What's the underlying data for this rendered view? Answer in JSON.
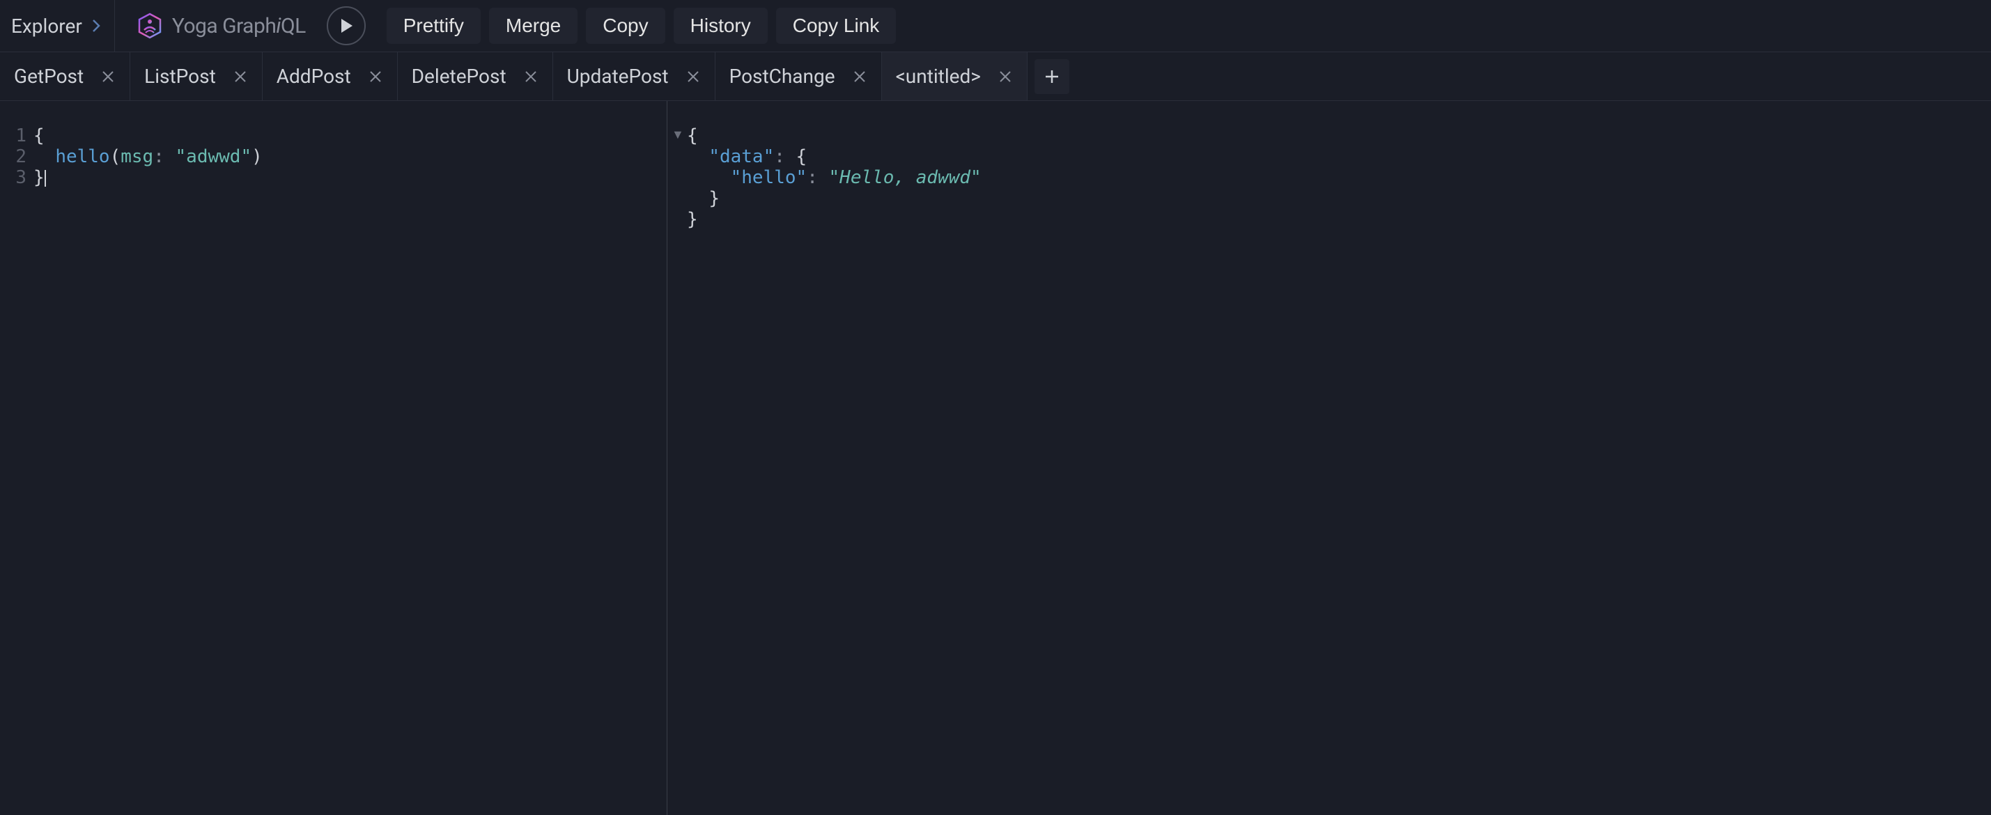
{
  "topbar": {
    "explorer_label": "Explorer",
    "app_name_pre": "Yoga Graph",
    "app_name_italic": "i",
    "app_name_post": "QL",
    "buttons": {
      "prettify": "Prettify",
      "merge": "Merge",
      "copy": "Copy",
      "history": "History",
      "copy_link": "Copy Link"
    }
  },
  "tabs": [
    {
      "label": "GetPost",
      "active": false
    },
    {
      "label": "ListPost",
      "active": false
    },
    {
      "label": "AddPost",
      "active": false
    },
    {
      "label": "DeletePost",
      "active": false
    },
    {
      "label": "UpdatePost",
      "active": false
    },
    {
      "label": "PostChange",
      "active": false
    },
    {
      "label": "<untitled>",
      "active": true
    }
  ],
  "query": {
    "line_numbers": [
      "1",
      "2",
      "3"
    ],
    "tokens": {
      "open_brace": "{",
      "field": "hello",
      "open_paren": "(",
      "arg_name": "msg",
      "colon": ":",
      "arg_value": "\"adwwd\"",
      "close_paren": ")",
      "close_brace": "}"
    }
  },
  "result": {
    "tokens": {
      "open_brace1": "{",
      "key_data": "\"data\"",
      "colon": ":",
      "open_brace2": "{",
      "key_hello": "\"hello\"",
      "val_hello": "\"Hello, adwwd\"",
      "close_brace2": "}",
      "close_brace1": "}"
    }
  },
  "icons": {
    "fold_marker": "▼"
  }
}
